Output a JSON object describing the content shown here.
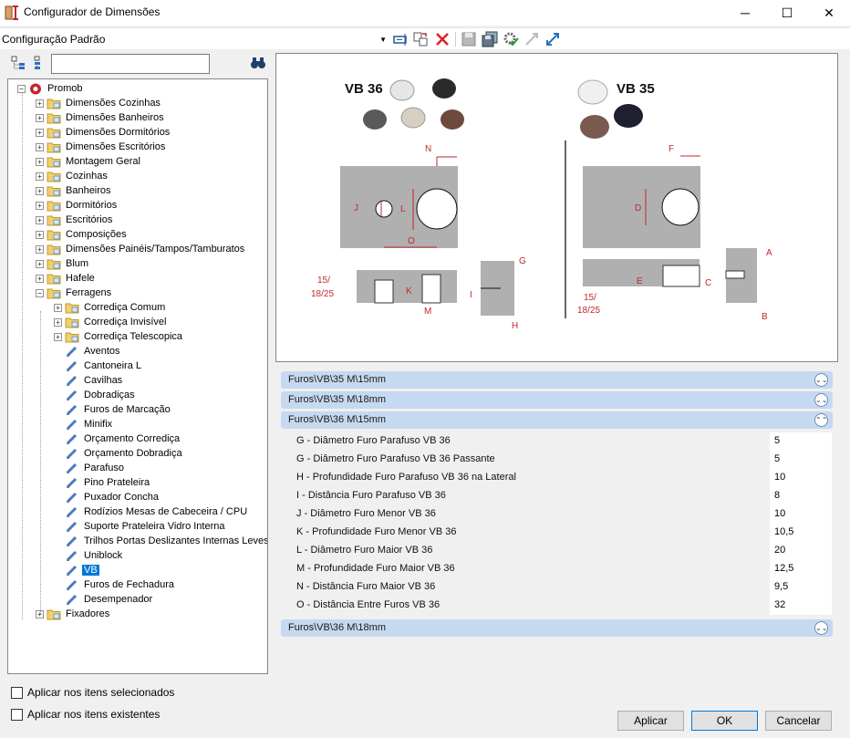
{
  "window": {
    "title": "Configurador de Dimensões",
    "minimize": "─",
    "maximize": "☐",
    "close": "✕"
  },
  "toolbar": {
    "config_value": "Configuração Padrão"
  },
  "tree": {
    "search_value": "",
    "root": "Promob",
    "level1": [
      "Dimensões Cozinhas",
      "Dimensões Banheiros",
      "Dimensões Dormitórios",
      "Dimensões Escritórios",
      "Montagem Geral",
      "Cozinhas",
      "Banheiros",
      "Dormitórios",
      "Escritórios",
      "Composições",
      "Dimensões Painéis/Tampos/Tamburatos",
      "Blum",
      "Hafele",
      "Ferragens"
    ],
    "ferragens_folders": [
      "Corrediça Comum",
      "Corrediça Invisível",
      "Corrediça Telescopica"
    ],
    "ferragens_items": [
      "Aventos",
      "Cantoneira L",
      "Cavilhas",
      "Dobradiças",
      "Furos de Marcação",
      "Minifix",
      "Orçamento Corrediça",
      "Orçamento Dobradiça",
      "Parafuso",
      "Pino Prateleira",
      "Puxador Concha",
      "Rodízios Mesas de Cabeceira / CPU",
      "Suporte Prateleira Vidro Interna",
      "Trilhos Portas Deslizantes Internas Leves",
      "Uniblock",
      "VB",
      "Furos de Fechadura",
      "Desempenador"
    ],
    "selected": "VB",
    "last": "Fixadores"
  },
  "options": {
    "apply_selected": "Aplicar nos itens selecionados",
    "apply_existing": "Aplicar nos itens existentes"
  },
  "diagram": {
    "vb36_title": "VB 36",
    "vb35_title": "VB 35",
    "letters": {
      "N": "N",
      "J": "J",
      "L": "L",
      "O": "O",
      "F": "F",
      "D": "D",
      "G": "G",
      "I": "I",
      "K": "K",
      "M": "M",
      "H": "H",
      "A": "A",
      "C": "C",
      "E": "E",
      "B": "B"
    },
    "thick1a": "15/",
    "thick1b": "18/25",
    "thick2a": "15/",
    "thick2b": "18/25"
  },
  "sections": [
    {
      "label": "Furos\\VB\\35 M\\15mm",
      "chev": "⌄⌄"
    },
    {
      "label": "Furos\\VB\\35 M\\18mm",
      "chev": "⌄⌄"
    },
    {
      "label": "Furos\\VB\\36 M\\15mm",
      "chev": "⌃⌃"
    },
    {
      "label": "Furos\\VB\\36 M\\18mm",
      "chev": "⌄⌄"
    }
  ],
  "properties": [
    {
      "name": "G - Diâmetro Furo Parafuso VB 36",
      "value": "5"
    },
    {
      "name": "G - Diâmetro Furo Parafuso VB 36 Passante",
      "value": "5"
    },
    {
      "name": "H - Profundidade Furo Parafuso VB 36 na Lateral",
      "value": "10"
    },
    {
      "name": "I - Distância Furo Parafuso VB 36",
      "value": "8"
    },
    {
      "name": "J - Diâmetro Furo Menor VB 36",
      "value": "10"
    },
    {
      "name": "K - Profundidade Furo Menor VB 36",
      "value": "10,5"
    },
    {
      "name": "L - Diâmetro Furo Maior VB 36",
      "value": "20"
    },
    {
      "name": "M - Profundidade Furo Maior VB 36",
      "value": "12,5"
    },
    {
      "name": "N - Distância Furo Maior VB 36",
      "value": "9,5"
    },
    {
      "name": "O - Distância Entre Furos VB 36",
      "value": "32"
    }
  ],
  "buttons": {
    "apply": "Aplicar",
    "ok": "OK",
    "cancel": "Cancelar"
  },
  "colors": {
    "accent": "#0078d7",
    "section_bar": "#c5d9f0",
    "dimension": "#c0282d",
    "part_gray": "#b0b0b0"
  }
}
